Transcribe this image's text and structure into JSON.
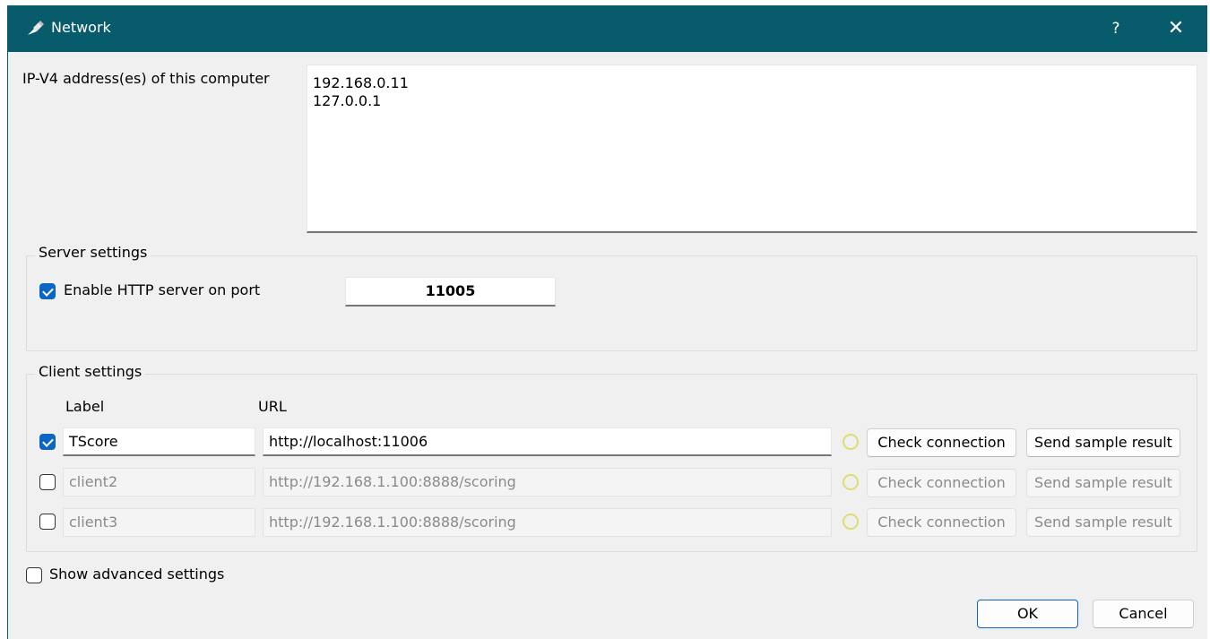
{
  "window": {
    "title": "Network",
    "help_label": "?",
    "close_label": "✕"
  },
  "ip": {
    "label": "IP-V4 address(es) of this computer",
    "addresses": "192.168.0.11\n127.0.0.1"
  },
  "server": {
    "group_title": "Server settings",
    "enable_label": "Enable HTTP server on port",
    "enabled": true,
    "port": "11005"
  },
  "client": {
    "group_title": "Client settings",
    "label_header": "Label",
    "url_header": "URL",
    "rows": [
      {
        "checked": true,
        "label": "TScore",
        "url": "http://localhost:11006",
        "check_label": "Check connection",
        "send_label": "Send sample result"
      },
      {
        "checked": false,
        "label": "client2",
        "url": "http://192.168.1.100:8888/scoring",
        "check_label": "Check connection",
        "send_label": "Send sample result"
      },
      {
        "checked": false,
        "label": "client3",
        "url": "http://192.168.1.100:8888/scoring",
        "check_label": "Check connection",
        "send_label": "Send sample result"
      }
    ]
  },
  "advanced": {
    "label": "Show advanced settings",
    "checked": false
  },
  "buttons": {
    "ok": "OK",
    "cancel": "Cancel"
  },
  "colors": {
    "titlebar": "#075b6b",
    "accent": "#0b66c3",
    "status_idle": "#dede6f"
  }
}
